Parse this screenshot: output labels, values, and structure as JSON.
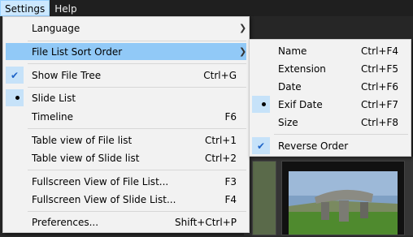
{
  "menubar": {
    "items": [
      {
        "label": "Settings",
        "active": true
      },
      {
        "label": "Help",
        "active": false
      }
    ]
  },
  "settings_menu": {
    "language": {
      "label": "Language",
      "submenu_icon": "chevron-right-icon"
    },
    "file_list_sort_order": {
      "label": "File List Sort Order",
      "submenu_icon": "chevron-right-icon",
      "highlighted": true
    },
    "show_file_tree": {
      "label": "Show File Tree",
      "shortcut": "Ctrl+G",
      "checked": true
    },
    "slide_list": {
      "label": "Slide List",
      "selected": true
    },
    "timeline": {
      "label": "Timeline",
      "shortcut": "F6"
    },
    "table_view_file_list": {
      "label": "Table view of File list",
      "shortcut": "Ctrl+1"
    },
    "table_view_slide_list": {
      "label": "Table view of Slide list",
      "shortcut": "Ctrl+2"
    },
    "fullscreen_file_list": {
      "label": "Fullscreen View of File List...",
      "shortcut": "F3"
    },
    "fullscreen_slide_list": {
      "label": "Fullscreen View of Slide List...",
      "shortcut": "F4"
    },
    "preferences": {
      "label": "Preferences...",
      "shortcut": "Shift+Ctrl+P"
    }
  },
  "sort_submenu": {
    "name": {
      "label": "Name",
      "shortcut": "Ctrl+F4"
    },
    "extension": {
      "label": "Extension",
      "shortcut": "Ctrl+F5"
    },
    "date": {
      "label": "Date",
      "shortcut": "Ctrl+F6"
    },
    "exif_date": {
      "label": "Exif Date",
      "shortcut": "Ctrl+F7",
      "selected": true
    },
    "size": {
      "label": "Size",
      "shortcut": "Ctrl+F8"
    },
    "reverse_order": {
      "label": "Reverse Order",
      "checked": true
    }
  },
  "colors": {
    "menu_bg": "#f2f2f2",
    "highlight": "#91c9f7",
    "mark_bg": "#c6e2f9",
    "check": "#1e64c8",
    "menubar_bg": "#1f1f1f"
  }
}
